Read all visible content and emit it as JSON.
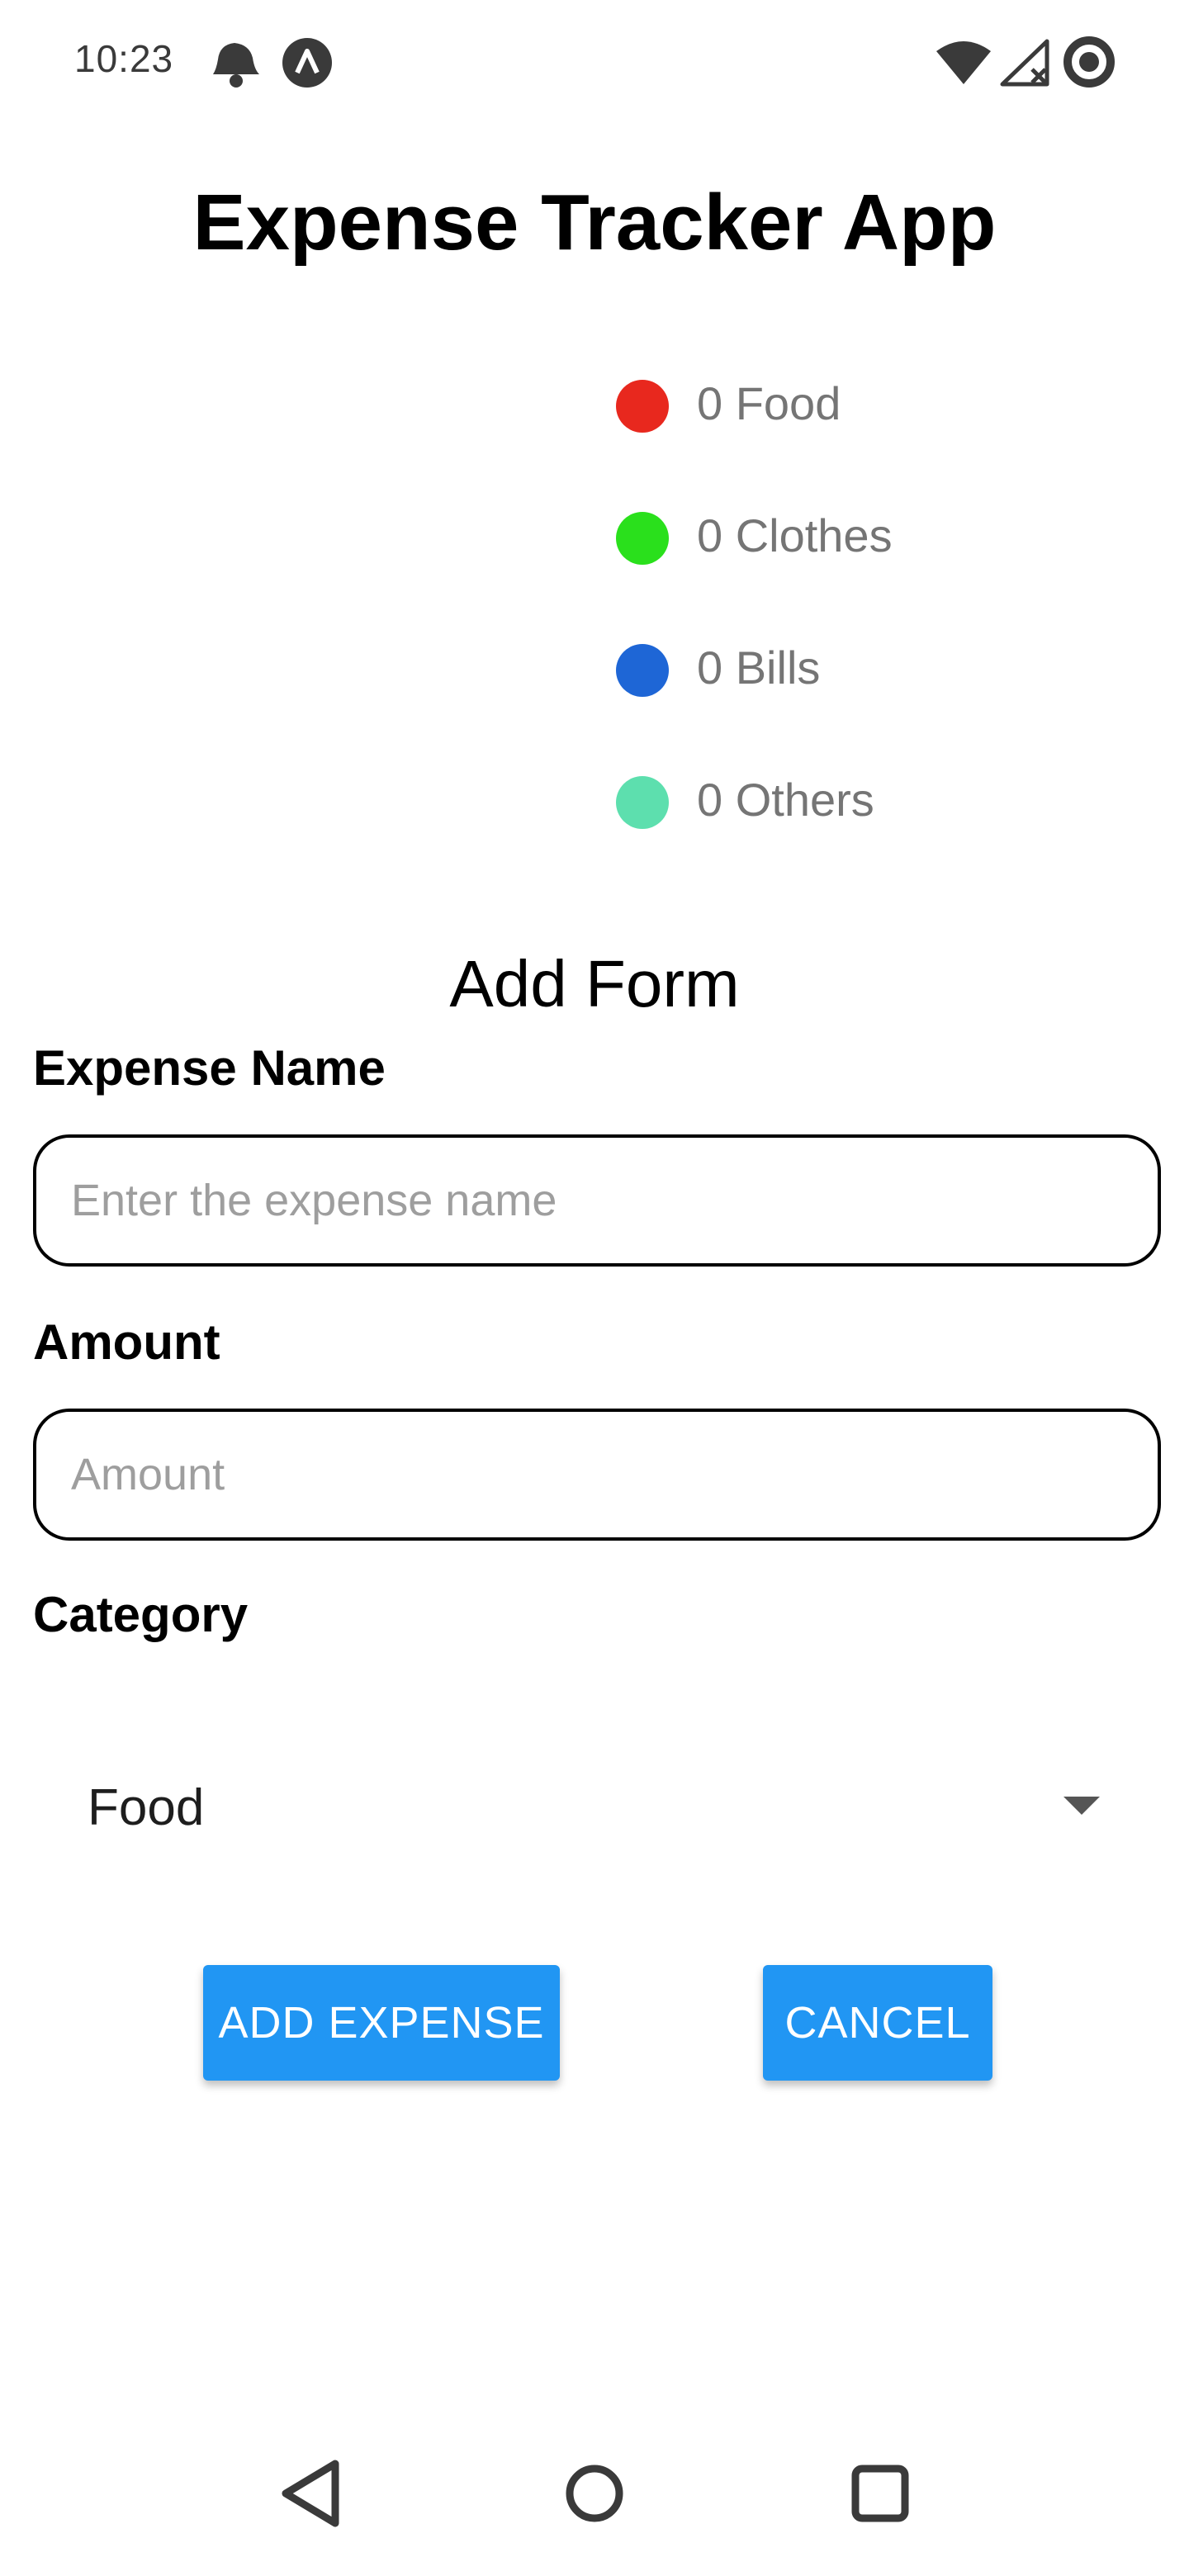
{
  "status_bar": {
    "time": "10:23",
    "icons": [
      "notification-bell-icon",
      "app-a-icon",
      "wifi-icon",
      "cell-signal-icon",
      "sync-icon"
    ]
  },
  "app": {
    "title": "Expense Tracker App"
  },
  "legend": [
    {
      "label": "0 Food",
      "color": "#e8281e"
    },
    {
      "label": "0 Clothes",
      "color": "#2ae01c"
    },
    {
      "label": "0 Bills",
      "color": "#1e66d6"
    },
    {
      "label": "0 Others",
      "color": "#5ddfae"
    }
  ],
  "form": {
    "title": "Add Form",
    "expense_name": {
      "label": "Expense Name",
      "placeholder": "Enter the expense name",
      "value": ""
    },
    "amount": {
      "label": "Amount",
      "placeholder": "Amount",
      "value": ""
    },
    "category": {
      "label": "Category",
      "selected": "Food"
    },
    "add_button": "ADD EXPENSE",
    "cancel_button": "CANCEL"
  },
  "nav_bar": {
    "icons": [
      "back-icon",
      "home-icon",
      "recents-icon"
    ]
  },
  "colors": {
    "accent": "#2196f3",
    "legend_text": "#757575"
  }
}
